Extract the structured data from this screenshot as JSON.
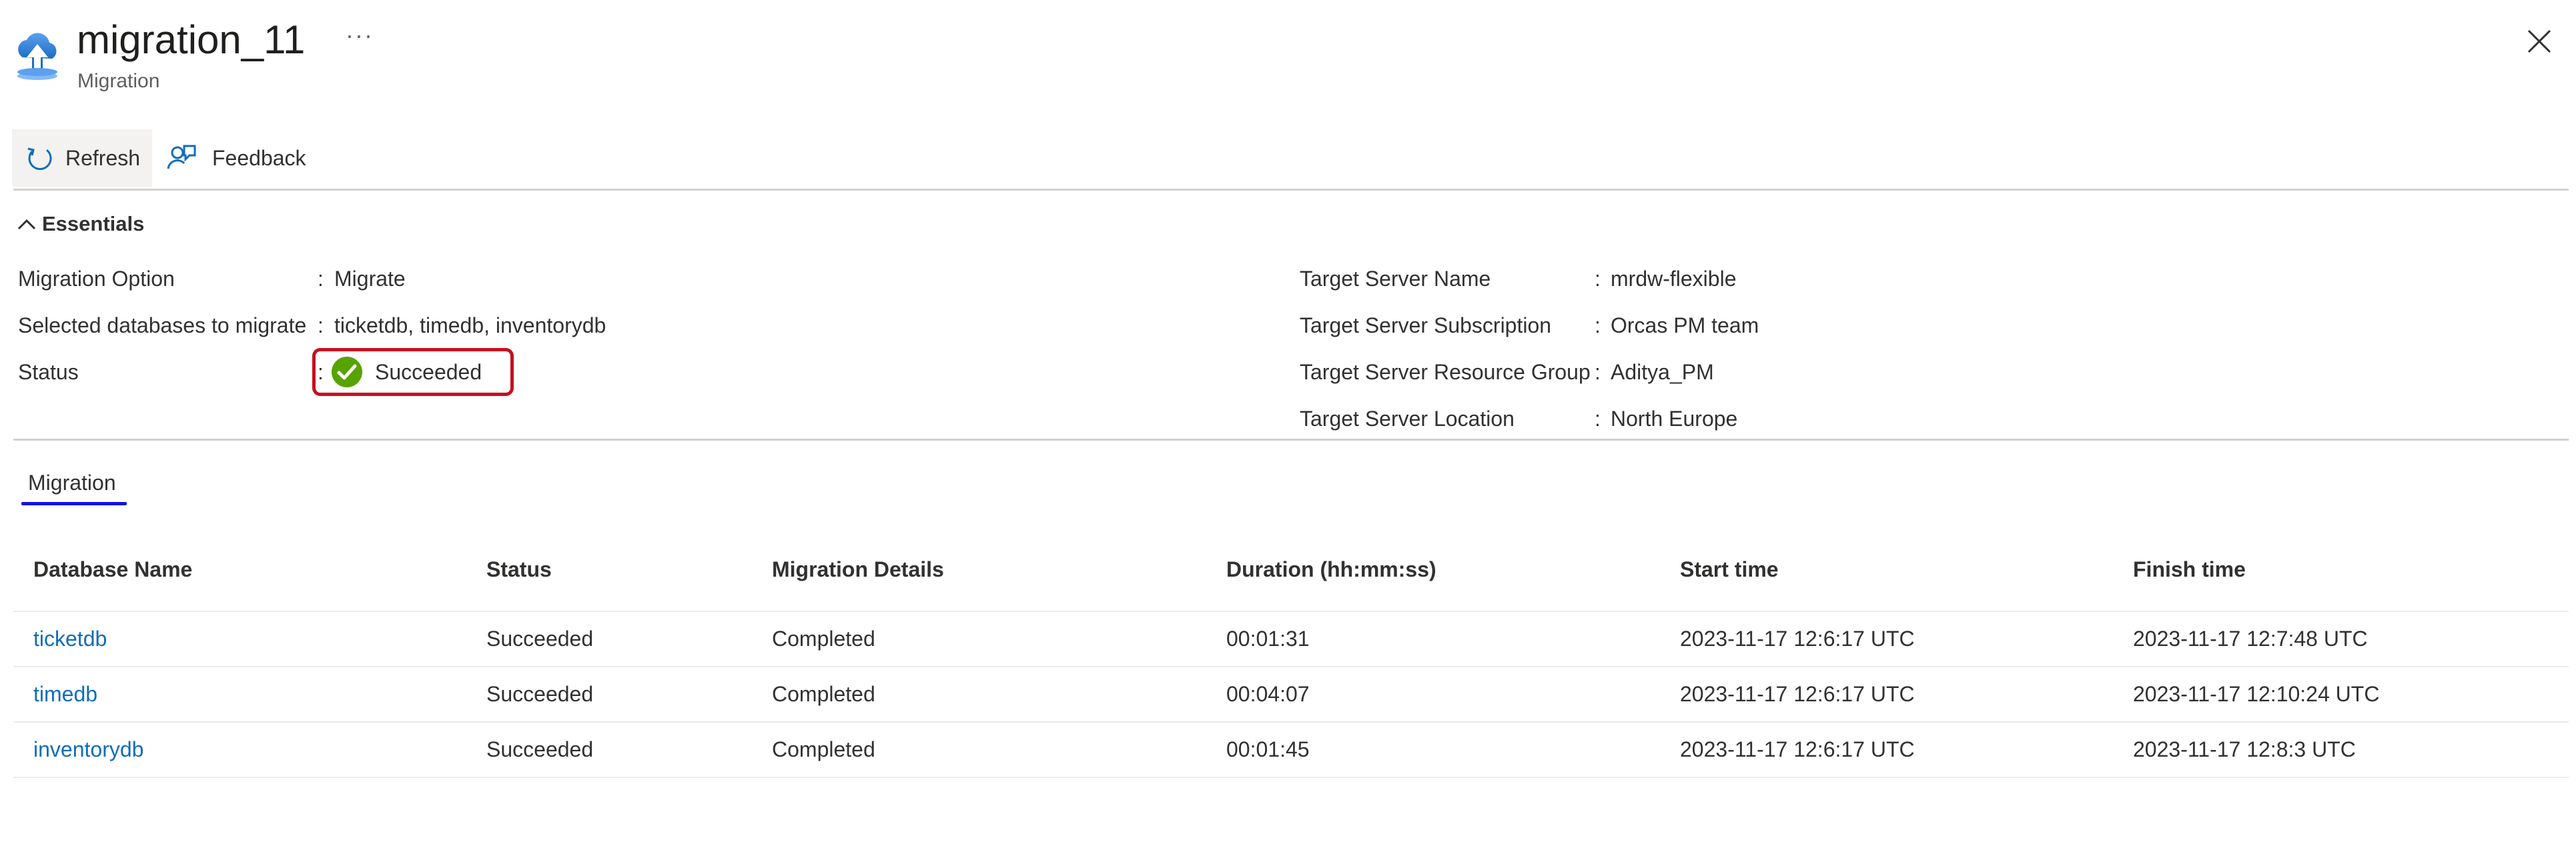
{
  "header": {
    "title": "migration_11",
    "subtitle": "Migration",
    "more_label": "···"
  },
  "toolbar": {
    "refresh_label": "Refresh",
    "feedback_label": "Feedback"
  },
  "essentials": {
    "toggle_label": "Essentials",
    "separator": ":",
    "left": [
      {
        "label": "Migration Option",
        "value": "Migrate"
      },
      {
        "label": "Selected databases to migrate",
        "value": "ticketdb, timedb, inventorydb"
      },
      {
        "label": "Status",
        "value": "Succeeded"
      }
    ],
    "right": [
      {
        "label": "Target Server Name",
        "value": "mrdw-flexible"
      },
      {
        "label": "Target Server Subscription",
        "value": "Orcas PM team"
      },
      {
        "label": "Target Server Resource Group",
        "value": "Aditya_PM"
      },
      {
        "label": "Target Server Location",
        "value": "North Europe"
      }
    ]
  },
  "tabs": [
    {
      "label": "Migration",
      "active": true
    }
  ],
  "table": {
    "headers": [
      "Database Name",
      "Status",
      "Migration Details",
      "Duration (hh:mm:ss)",
      "Start time",
      "Finish time"
    ],
    "rows": [
      [
        "ticketdb",
        "Succeeded",
        "Completed",
        "00:01:31",
        "2023-11-17 12:6:17 UTC",
        "2023-11-17 12:7:48 UTC"
      ],
      [
        "timedb",
        "Succeeded",
        "Completed",
        "00:04:07",
        "2023-11-17 12:6:17 UTC",
        "2023-11-17 12:10:24 UTC"
      ],
      [
        "inventorydb",
        "Succeeded",
        "Completed",
        "00:01:45",
        "2023-11-17 12:6:17 UTC",
        "2023-11-17 12:8:3 UTC"
      ]
    ]
  },
  "icons": {
    "app": "cloud-upload-icon",
    "refresh": "refresh-icon",
    "feedback": "feedback-icon",
    "close": "close-icon",
    "collapse": "chevron-up-icon",
    "status": "success-check-icon"
  },
  "colors": {
    "link": "#0f6cbd",
    "success": "#57a300",
    "highlight": "#c50f1f",
    "tab_underline": "#0f0fe8"
  }
}
